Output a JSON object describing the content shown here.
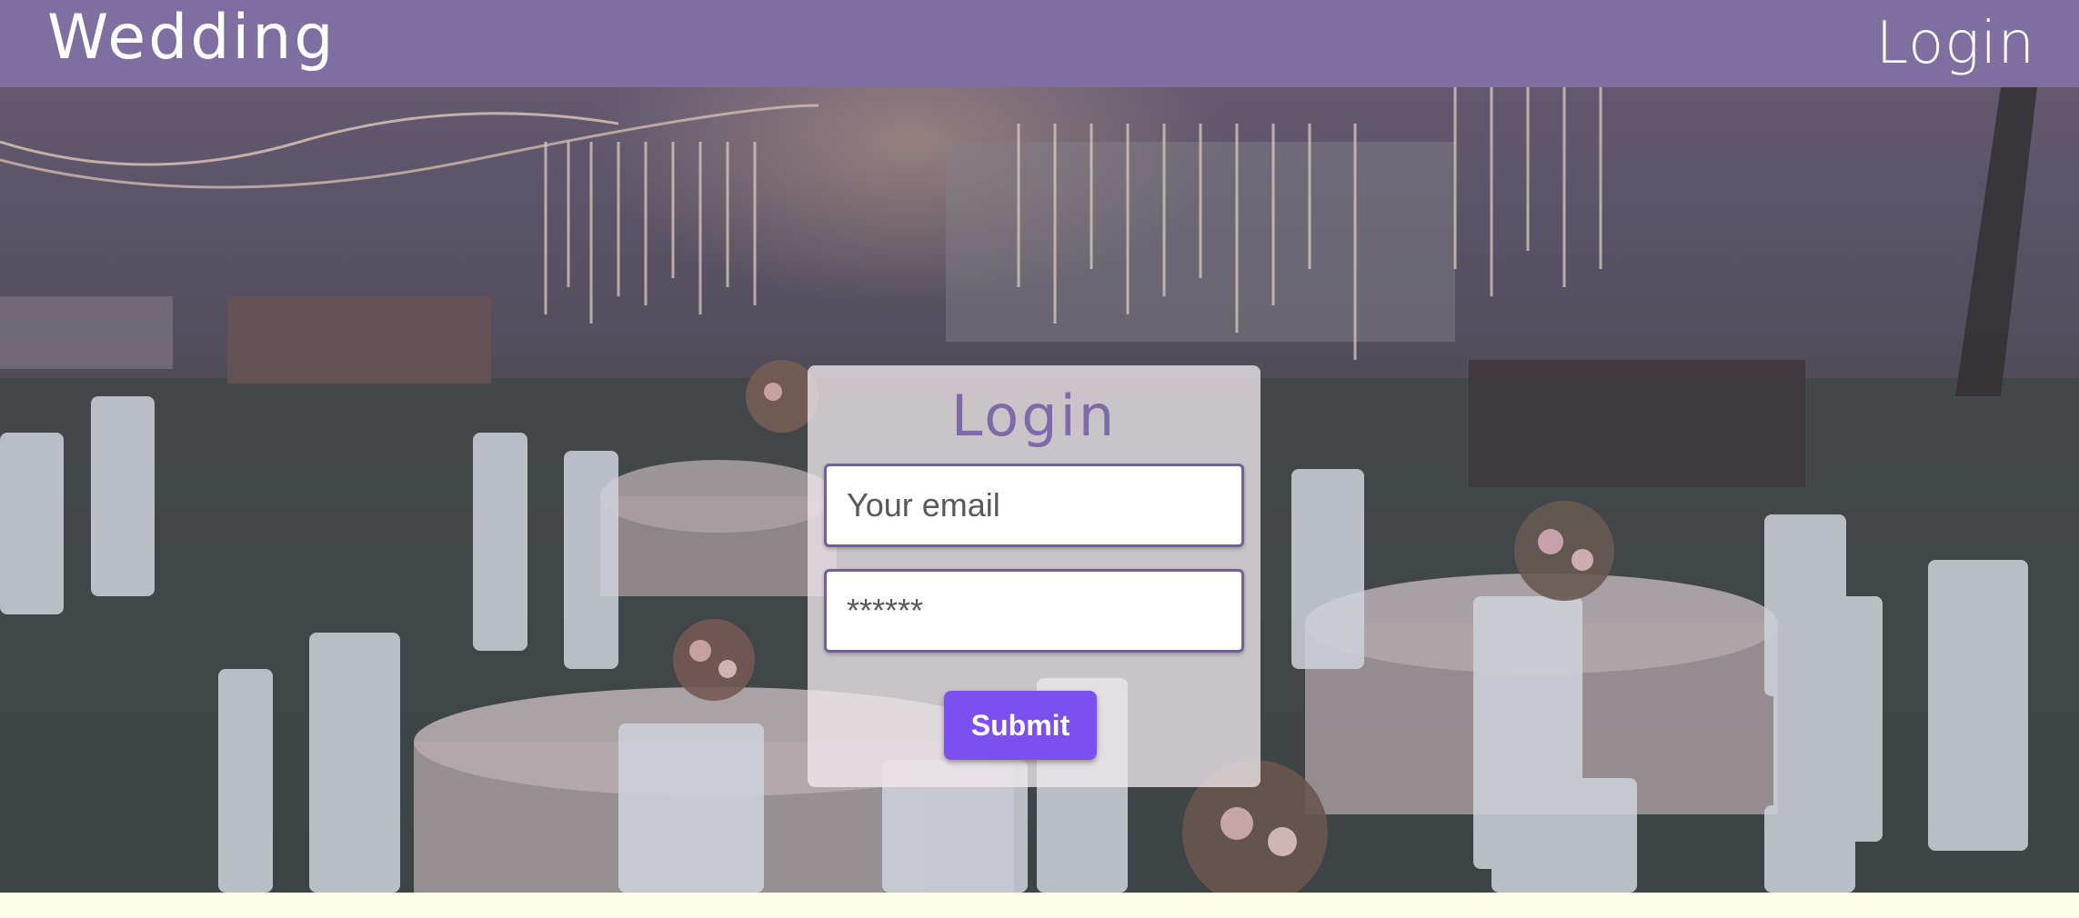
{
  "header": {
    "brand": "Wedding",
    "login_link": "Login"
  },
  "login_form": {
    "title": "Login",
    "email_placeholder": "Your email",
    "password_placeholder": "******",
    "submit_label": "Submit"
  },
  "colors": {
    "navbar": "#7f6fa1",
    "title": "#7e6aa8",
    "submit": "#7c4ff0",
    "field_border": "#73609a",
    "page_background": "#fdfde7"
  }
}
